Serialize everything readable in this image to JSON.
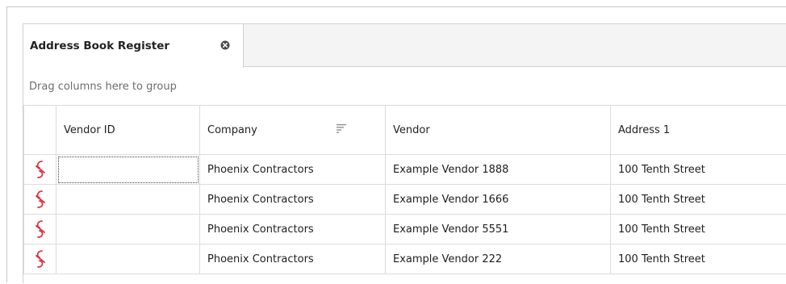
{
  "tab": {
    "title": "Address Book Register",
    "close_icon": "close-circle-icon"
  },
  "group_panel": {
    "hint": "Drag columns here to group"
  },
  "grid": {
    "columns": [
      {
        "label": ""
      },
      {
        "label": "Vendor ID"
      },
      {
        "label": "Company",
        "sort_icon": "sort-descending-icon"
      },
      {
        "label": "Vendor"
      },
      {
        "label": "Address 1"
      }
    ],
    "rows": [
      {
        "icon": "unlinked-icon",
        "vendor_id": "",
        "company": "Phoenix Contractors",
        "vendor": "Example Vendor 1888",
        "address1": "100 Tenth Street"
      },
      {
        "icon": "unlinked-icon",
        "vendor_id": "",
        "company": "Phoenix Contractors",
        "vendor": "Example Vendor 1666",
        "address1": "100 Tenth Street"
      },
      {
        "icon": "unlinked-icon",
        "vendor_id": "",
        "company": "Phoenix Contractors",
        "vendor": "Example Vendor 5551",
        "address1": "100 Tenth Street"
      },
      {
        "icon": "unlinked-icon",
        "vendor_id": "",
        "company": "Phoenix Contractors",
        "vendor": "Example Vendor 222",
        "address1": "100 Tenth Street"
      }
    ]
  },
  "colors": {
    "unlinked_icon": "#e0313b",
    "header_text": "#222222",
    "hint_text": "#6d6d6d",
    "grid_line": "#dcdcdc"
  }
}
